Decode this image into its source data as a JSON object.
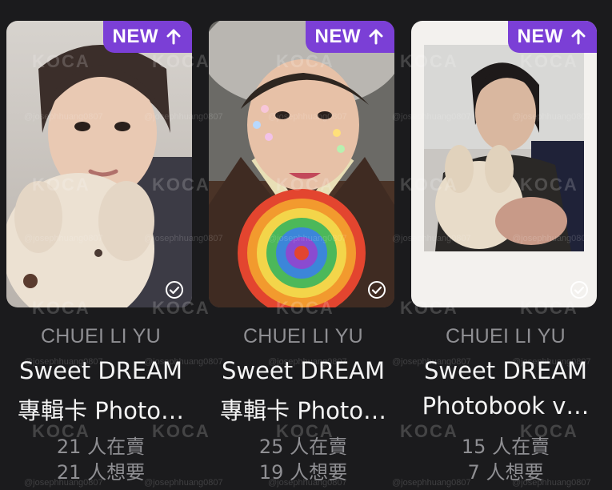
{
  "cards": [
    {
      "badge": "NEW",
      "artist": "CHUEI LI YU",
      "title_line1": "Sweet DREAM",
      "title_line2": "專輯卡 Photo…",
      "selling": "21 人在賣",
      "wanting": "21 人想要",
      "badge_icon": "arrow-up-icon",
      "status_icon": "check-circle-icon"
    },
    {
      "badge": "NEW",
      "artist": "CHUEI LI YU",
      "title_line1": "Sweet DREAM",
      "title_line2": "專輯卡 Photo…",
      "selling": "25 人在賣",
      "wanting": "19 人想要",
      "badge_icon": "arrow-up-icon",
      "status_icon": "check-circle-icon"
    },
    {
      "badge": "NEW",
      "artist": "CHUEI LI YU",
      "title_line1": "Sweet DREAM",
      "title_line2": "Photobook v…",
      "selling": "15 人在賣",
      "wanting": "7 人想要",
      "badge_icon": "arrow-up-icon",
      "status_icon": "check-circle-icon"
    }
  ],
  "watermark": {
    "logo": "KOCA",
    "handle": "@josephhuang0807"
  },
  "colors": {
    "background": "#1b1b1d",
    "badge": "#7b3fd6",
    "title": "#f4f4f4",
    "muted": "#8f8f93"
  }
}
